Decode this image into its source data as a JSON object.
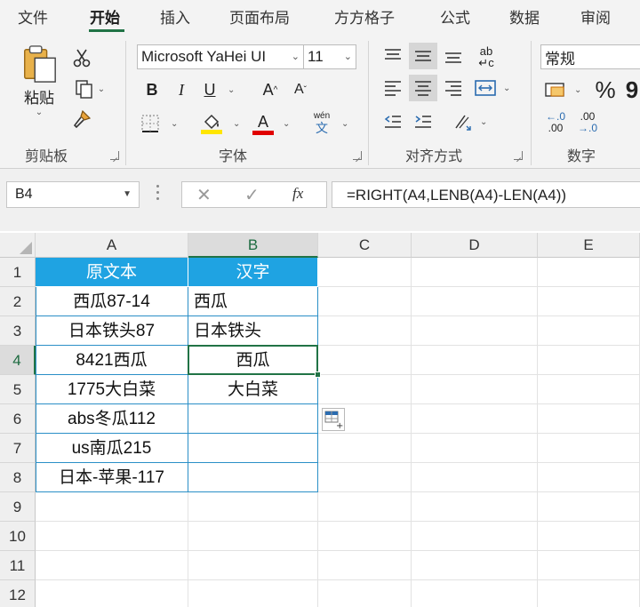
{
  "ribbon_tabs": [
    "文件",
    "开始",
    "插入",
    "页面布局",
    "方方格子",
    "公式",
    "数据",
    "审阅"
  ],
  "active_tab": "开始",
  "clipboard": {
    "paste_label": "粘贴",
    "group_label": "剪贴板"
  },
  "font": {
    "name": "Microsoft YaHei UI",
    "size": "11",
    "bold": "B",
    "italic": "I",
    "underline": "U",
    "grow": "A",
    "shrink": "A",
    "wen_top": "wén",
    "wen_bottom": "文",
    "font_color_letter": "A",
    "group_label": "字体",
    "fill_color": "#ffe600",
    "font_color": "#e00000"
  },
  "alignment": {
    "group_label": "对齐方式",
    "wrap_top": "ab",
    "wrap_bottom": "c"
  },
  "number": {
    "format": "常规",
    "percent": "%",
    "comma": "9",
    "inc_top": ".0",
    "inc_bottom": ".00",
    "dec_top": ".00",
    "dec_bottom": ".0",
    "group_label": "数字"
  },
  "formula_bar": {
    "name_box": "B4",
    "fx": "fx",
    "formula": "=RIGHT(A4,LENB(A4)-LEN(A4))"
  },
  "columns": [
    "A",
    "B",
    "C",
    "D",
    "E"
  ],
  "rows": [
    "1",
    "2",
    "3",
    "4",
    "5",
    "6",
    "7",
    "8",
    "9",
    "10",
    "11",
    "12"
  ],
  "table": {
    "header_a": "原文本",
    "header_b": "汉字",
    "col_a": [
      "西瓜87-14",
      "日本铁头87",
      "8421西瓜",
      "1775大白菜",
      "abs冬瓜112",
      "us南瓜215",
      "日本-苹果-117"
    ],
    "col_b": [
      "西瓜",
      "日本铁头",
      "西瓜",
      "大白菜",
      "",
      "",
      ""
    ]
  },
  "colors": {
    "accent_green": "#217346",
    "table_header": "#1fa3e2",
    "table_border": "#2a8fc7"
  }
}
